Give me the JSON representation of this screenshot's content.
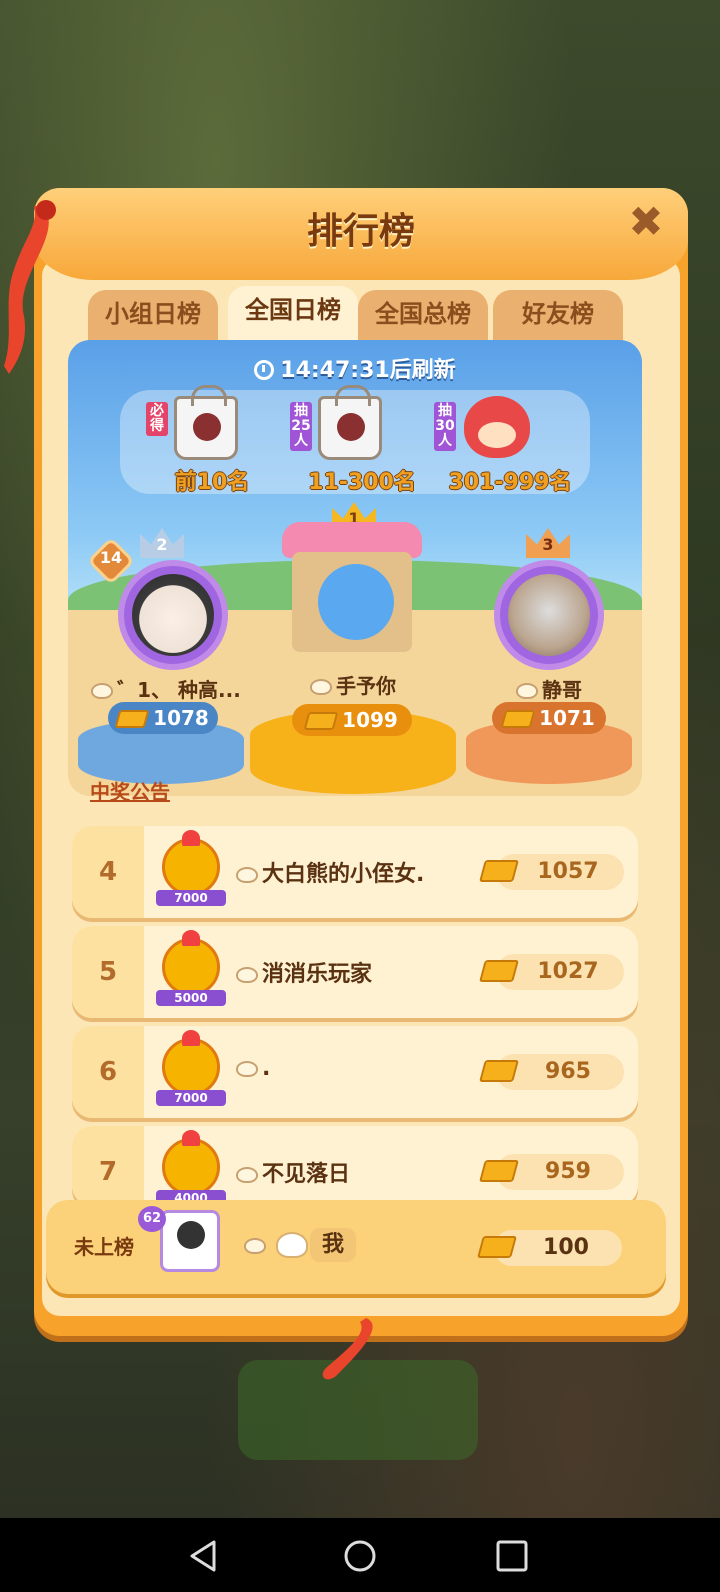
{
  "panel": {
    "title": "排行榜",
    "close_label": "✖"
  },
  "tabs": [
    {
      "label": "小组日榜",
      "active": false
    },
    {
      "label": "全国日榜",
      "active": true
    },
    {
      "label": "全国总榜",
      "active": false
    },
    {
      "label": "好友榜",
      "active": false
    }
  ],
  "refresh_text": "14:47:31后刷新",
  "rewards": [
    {
      "tag": "必得",
      "range": "前10名",
      "icon": "gift-bag-icon"
    },
    {
      "tag": "抽25人",
      "range": "11-300名",
      "icon": "gift-bag-icon"
    },
    {
      "tag": "抽30人",
      "range": "301-999名",
      "icon": "fox-plush-icon"
    }
  ],
  "podium": {
    "first": {
      "rank": "1",
      "name": "手予你",
      "score": "1099"
    },
    "second": {
      "rank": "2",
      "name": "゛1、 种高...",
      "score": "1078",
      "level": "14"
    },
    "third": {
      "rank": "3",
      "name": "静哥",
      "score": "1071"
    }
  },
  "announcement_label": "中奖公告",
  "rows": [
    {
      "rank": "4",
      "name": "大白熊的小侄女.",
      "score": "1057",
      "badge": "7000"
    },
    {
      "rank": "5",
      "name": "消消乐玩家",
      "score": "1027",
      "badge": "5000"
    },
    {
      "rank": "6",
      "name": ".",
      "score": "965",
      "badge": "7000"
    },
    {
      "rank": "7",
      "name": "不见落日",
      "score": "959",
      "badge": "4000"
    }
  ],
  "me": {
    "status": "未上榜",
    "name": "我",
    "score": "100",
    "level": "62"
  },
  "background": {
    "title": "",
    "footer": ""
  },
  "colors": {
    "panel_orange": "#f7a22b",
    "panel_cream": "#fde6b6",
    "title_brown": "#7a3a10",
    "gold": "#f5b01c"
  }
}
